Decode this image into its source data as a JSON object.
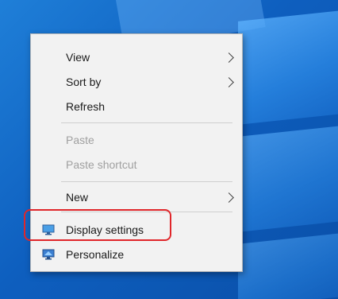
{
  "context_menu": {
    "items": [
      {
        "label": "View",
        "has_submenu": true,
        "disabled": false
      },
      {
        "label": "Sort by",
        "has_submenu": true,
        "disabled": false
      },
      {
        "label": "Refresh",
        "has_submenu": false,
        "disabled": false
      },
      {
        "label": "Paste",
        "has_submenu": false,
        "disabled": true
      },
      {
        "label": "Paste shortcut",
        "has_submenu": false,
        "disabled": true
      },
      {
        "label": "New",
        "has_submenu": true,
        "disabled": false
      },
      {
        "label": "Display settings",
        "icon": "display-icon",
        "highlighted": true
      },
      {
        "label": "Personalize",
        "icon": "personalize-icon"
      }
    ]
  },
  "colors": {
    "highlight": "#e0262a",
    "desktop": "#0e5fbf",
    "menu_bg": "#f2f2f2"
  }
}
